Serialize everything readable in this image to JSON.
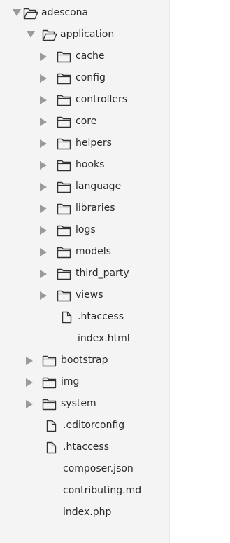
{
  "tree": [
    {
      "label": "adescona",
      "type": "folder",
      "expanded": true
    },
    {
      "label": "application",
      "type": "folder",
      "expanded": true
    },
    {
      "label": "cache",
      "type": "folder",
      "expanded": false
    },
    {
      "label": "config",
      "type": "folder",
      "expanded": false
    },
    {
      "label": "controllers",
      "type": "folder",
      "expanded": false
    },
    {
      "label": "core",
      "type": "folder",
      "expanded": false
    },
    {
      "label": "helpers",
      "type": "folder",
      "expanded": false
    },
    {
      "label": "hooks",
      "type": "folder",
      "expanded": false
    },
    {
      "label": "language",
      "type": "folder",
      "expanded": false
    },
    {
      "label": "libraries",
      "type": "folder",
      "expanded": false
    },
    {
      "label": "logs",
      "type": "folder",
      "expanded": false
    },
    {
      "label": "models",
      "type": "folder",
      "expanded": false
    },
    {
      "label": "third_party",
      "type": "folder",
      "expanded": false
    },
    {
      "label": "views",
      "type": "folder",
      "expanded": false
    },
    {
      "label": ".htaccess",
      "type": "file",
      "icon": "file-icon"
    },
    {
      "label": "index.html",
      "type": "file",
      "icon": "none"
    },
    {
      "label": "bootstrap",
      "type": "folder",
      "expanded": false
    },
    {
      "label": "img",
      "type": "folder",
      "expanded": false
    },
    {
      "label": "system",
      "type": "folder",
      "expanded": false
    },
    {
      "label": ".editorconfig",
      "type": "file",
      "icon": "file-icon"
    },
    {
      "label": ".htaccess",
      "type": "file",
      "icon": "file-icon"
    },
    {
      "label": "composer.json",
      "type": "file",
      "icon": "none"
    },
    {
      "label": "contributing.md",
      "type": "file",
      "icon": "none"
    },
    {
      "label": "index.php",
      "type": "file",
      "icon": "none"
    }
  ],
  "colors": {
    "panel_background": "#f4f4f4",
    "text": "#2a2a2a",
    "arrow": "#9a9a9a",
    "icon_stroke": "#333333"
  }
}
